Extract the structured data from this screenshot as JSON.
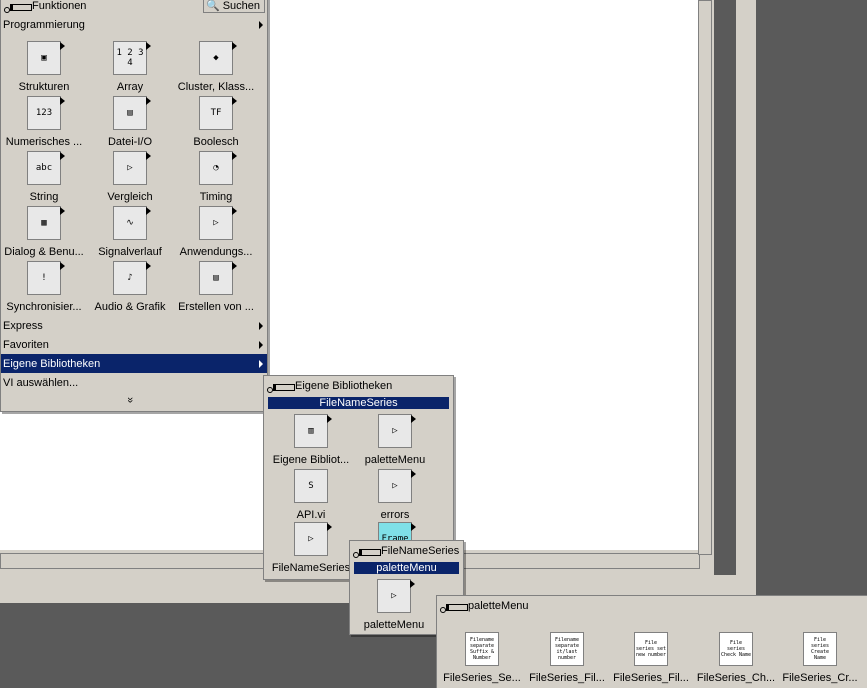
{
  "functions_palette": {
    "title": "Funktionen",
    "search_label": "Suchen",
    "category_top": "Programmierung",
    "icons": [
      {
        "label": "Strukturen",
        "glyph": "▣"
      },
      {
        "label": "Array",
        "glyph": "1 2 3 4"
      },
      {
        "label": "Cluster, Klass...",
        "glyph": "◆"
      },
      {
        "label": "Numerisches ...",
        "glyph": "123"
      },
      {
        "label": "Datei-I/O",
        "glyph": "▤"
      },
      {
        "label": "Boolesch",
        "glyph": "TF"
      },
      {
        "label": "String",
        "glyph": "abc"
      },
      {
        "label": "Vergleich",
        "glyph": "▷"
      },
      {
        "label": "Timing",
        "glyph": "◔"
      },
      {
        "label": "Dialog & Benu...",
        "glyph": "▦"
      },
      {
        "label": "Signalverlauf",
        "glyph": "∿"
      },
      {
        "label": "Anwendungs...",
        "glyph": "▷"
      },
      {
        "label": "Synchronisier...",
        "glyph": "!"
      },
      {
        "label": "Audio & Grafik",
        "glyph": "♪"
      },
      {
        "label": "Erstellen von ...",
        "glyph": "▤"
      }
    ],
    "menu": [
      {
        "label": "Express"
      },
      {
        "label": "Favoriten"
      },
      {
        "label": "Eigene Bibliotheken"
      },
      {
        "label": "VI auswählen..."
      }
    ],
    "more_glyph": "»"
  },
  "eigene_palette": {
    "title": "Eigene Bibliotheken",
    "selected": "FileNameSeries",
    "icons": [
      {
        "label": "Eigene Bibliot...",
        "glyph": "▥"
      },
      {
        "label": "paletteMenu",
        "glyph": "▷"
      },
      {
        "label": "API.vi",
        "glyph": "S"
      },
      {
        "label": "errors",
        "glyph": "▷"
      },
      {
        "label": "FileNameSeries",
        "glyph": "▷"
      },
      {
        "label": "",
        "glyph": "Frame"
      }
    ]
  },
  "filenameseries_palette": {
    "title": "FileNameSeries",
    "selected": "paletteMenu",
    "icons": [
      {
        "label": "paletteMenu",
        "glyph": "▷"
      }
    ]
  },
  "palettemenu_palette": {
    "title": "paletteMenu",
    "icons": [
      {
        "label": "FileSeries_Se...",
        "glyph": "Filename separate Suffix & Number"
      },
      {
        "label": "FileSeries_Fil...",
        "glyph": "Filename separate it/last number"
      },
      {
        "label": "FileSeries_Fil...",
        "glyph": "File series set new number"
      },
      {
        "label": "FileSeries_Ch...",
        "glyph": "File series Check Name"
      },
      {
        "label": "FileSeries_Cr...",
        "glyph": "File series Create Name"
      }
    ]
  }
}
